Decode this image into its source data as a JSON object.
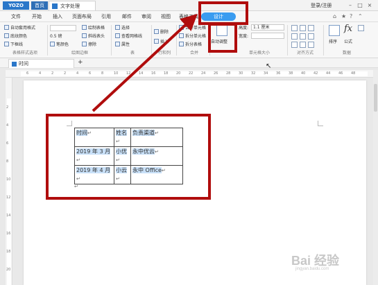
{
  "titlebar": {
    "logo": "YOZO",
    "home_tab": "首页",
    "doc_tab": "文字处理",
    "login": "登录/注册"
  },
  "menu": {
    "items": [
      "文件",
      "开始",
      "插入",
      "页面布局",
      "引用",
      "邮件",
      "审阅",
      "视图",
      "表格工具"
    ],
    "design_tab": "设计"
  },
  "ribbon": {
    "group1": {
      "items": [
        "自动套用格式",
        "底纹颜色",
        "下框线"
      ],
      "label": "表格样式选项"
    },
    "group2": {
      "line_width": "0.5",
      "line_unit": "磅",
      "pen_color": "笔颜色",
      "items": [
        "绘制表格",
        "斜线表头",
        "擦除"
      ],
      "label": "绘图边框"
    },
    "group3": {
      "items": [
        "选择",
        "查看网格线",
        "属性"
      ],
      "label": "表"
    },
    "group4": {
      "items": [
        "删除",
        "插入"
      ],
      "label": "行和列"
    },
    "group5": {
      "items": [
        "合并单元格",
        "拆分单元格",
        "拆分表格"
      ],
      "label": "合并"
    },
    "group6": {
      "auto_fit": "自动调整",
      "height_label": "高度:",
      "height_value": "1.1 厘米",
      "width_label": "宽度:",
      "label": "单元格大小"
    },
    "group7": {
      "label": "对齐方式"
    },
    "group8": {
      "sort": "排序",
      "formula": "公式",
      "label": "数据"
    }
  },
  "doc_tabs": {
    "active": "时间",
    "plus": "+"
  },
  "ruler": {
    "h_ticks": [
      "6",
      "4",
      "2",
      "2",
      "4",
      "6",
      "8",
      "10",
      "12",
      "14",
      "16",
      "18",
      "20",
      "22",
      "24",
      "26",
      "28",
      "30",
      "32",
      "34",
      "36",
      "38",
      "40",
      "42",
      "44",
      "46",
      "48"
    ],
    "v_ticks": [
      "2",
      "4",
      "6",
      "8",
      "10",
      "12",
      "14",
      "16",
      "18",
      "20"
    ]
  },
  "table": {
    "rows": [
      [
        "时间",
        "姓名",
        "负责渠道"
      ],
      [
        "2019 年 3 月",
        "小优",
        "永中优云"
      ],
      [
        "2019 年 4 月",
        "小云",
        "永中 Office"
      ]
    ]
  },
  "watermark": {
    "main": "Bai 经验",
    "sub": "jingyan.baidu.com"
  }
}
